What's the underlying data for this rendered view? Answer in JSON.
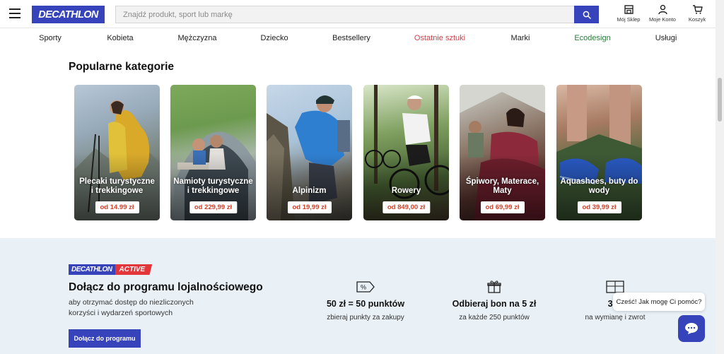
{
  "header": {
    "logo": "DECATHLON",
    "search_placeholder": "Znajdź produkt, sport lub markę",
    "icons": [
      {
        "name": "store-icon",
        "label": "Mój Sklep"
      },
      {
        "name": "account-icon",
        "label": "Moje Konto"
      },
      {
        "name": "cart-icon",
        "label": "Koszyk"
      }
    ]
  },
  "nav": {
    "items": [
      {
        "label": "Sporty",
        "color": "#222222"
      },
      {
        "label": "Kobieta",
        "color": "#222222"
      },
      {
        "label": "Mężczyzna",
        "color": "#222222"
      },
      {
        "label": "Dziecko",
        "color": "#222222"
      },
      {
        "label": "Bestsellery",
        "color": "#222222"
      },
      {
        "label": "Ostatnie sztuki",
        "color": "#d13f47"
      },
      {
        "label": "Marki",
        "color": "#222222"
      },
      {
        "label": "Ecodesign",
        "color": "#2f7a3f"
      },
      {
        "label": "Usługi",
        "color": "#222222"
      }
    ]
  },
  "categories": {
    "title": "Popularne kategorie",
    "items": [
      {
        "name": "Plecaki turystyczne i trekkingowe",
        "price": "od 14.99 zł"
      },
      {
        "name": "Namioty turystyczne i trekkingowe",
        "price": "od 229,99 zł"
      },
      {
        "name": "Alpinizm",
        "price": "od 19,99 zł"
      },
      {
        "name": "Rowery",
        "price": "od 849,00 zł"
      },
      {
        "name": "Śpiwory, Materace, Maty",
        "price": "od 69,99 zł"
      },
      {
        "name": "Aquashoes, buty do wody",
        "price": "od 39,99 zł"
      }
    ]
  },
  "loyalty": {
    "logo_left": "DECATHLON",
    "logo_right": "ACTIVE",
    "title": "Dołącz do programu lojalnościowego",
    "description": "aby otrzymać dostęp do niezliczonych korzyści i wydarzeń sportowych",
    "button": "Dołącz do programu",
    "benefits": [
      {
        "icon": "percent-tag-icon",
        "title": "50 zł = 50 punktów",
        "subtitle": "zbieraj punkty za zakupy"
      },
      {
        "icon": "gift-icon",
        "title": "Odbieraj bon na 5 zł",
        "subtitle": "za każde 250 punktów"
      },
      {
        "icon": "gift-card-icon",
        "title": "365",
        "subtitle": "na wymianę i zwrot"
      }
    ]
  },
  "chat": {
    "greeting": "Cześć! Jak mogę Ci pomóc?"
  },
  "colors": {
    "brand_blue": "#3643ba",
    "price_red": "#d13f28",
    "loyalty_bg": "#e9f1f7"
  }
}
